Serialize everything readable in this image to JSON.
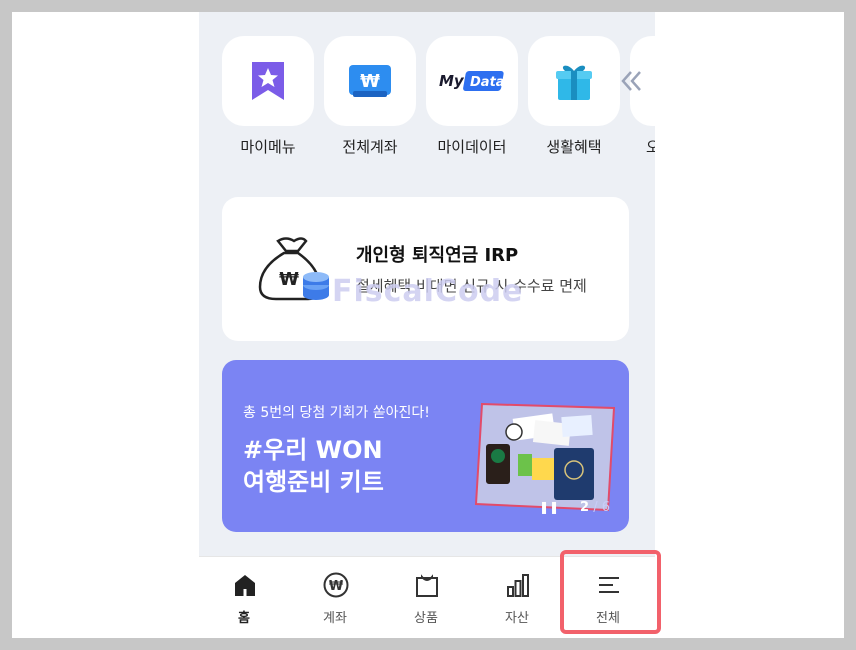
{
  "quick_menu": {
    "items": [
      {
        "label": "마이메뉴",
        "icon": "bookmark-star-icon"
      },
      {
        "label": "전체계좌",
        "icon": "won-wallet-icon"
      },
      {
        "label": "마이데이터",
        "icon": "mydata-icon",
        "logo_text": "MyData"
      },
      {
        "label": "생활혜택",
        "icon": "gift-icon"
      }
    ],
    "partial_label": "오",
    "scroll_icon": "double-chevron-left-icon"
  },
  "irp_card": {
    "title": "개인형 퇴직연금 IRP",
    "subtitle": "절세혜택 비대면 신규 시 수수료 면제"
  },
  "watermark": "FiscalCode",
  "banner": {
    "subtitle": "총 5번의 당첨 기회가 쏟아진다!",
    "title_line1": "#우리 WON",
    "title_line2": "여행준비 키트",
    "pager_current": "2",
    "pager_total": "/ 6",
    "background": "#7b84f3"
  },
  "bottom_nav": {
    "items": [
      {
        "label": "홈",
        "icon": "home-icon"
      },
      {
        "label": "계좌",
        "icon": "won-coin-icon"
      },
      {
        "label": "상품",
        "icon": "shopping-bag-icon"
      },
      {
        "label": "자산",
        "icon": "bar-chart-icon"
      },
      {
        "label": "전체",
        "icon": "menu-icon"
      }
    ],
    "highlight_color": "#f2616b"
  }
}
